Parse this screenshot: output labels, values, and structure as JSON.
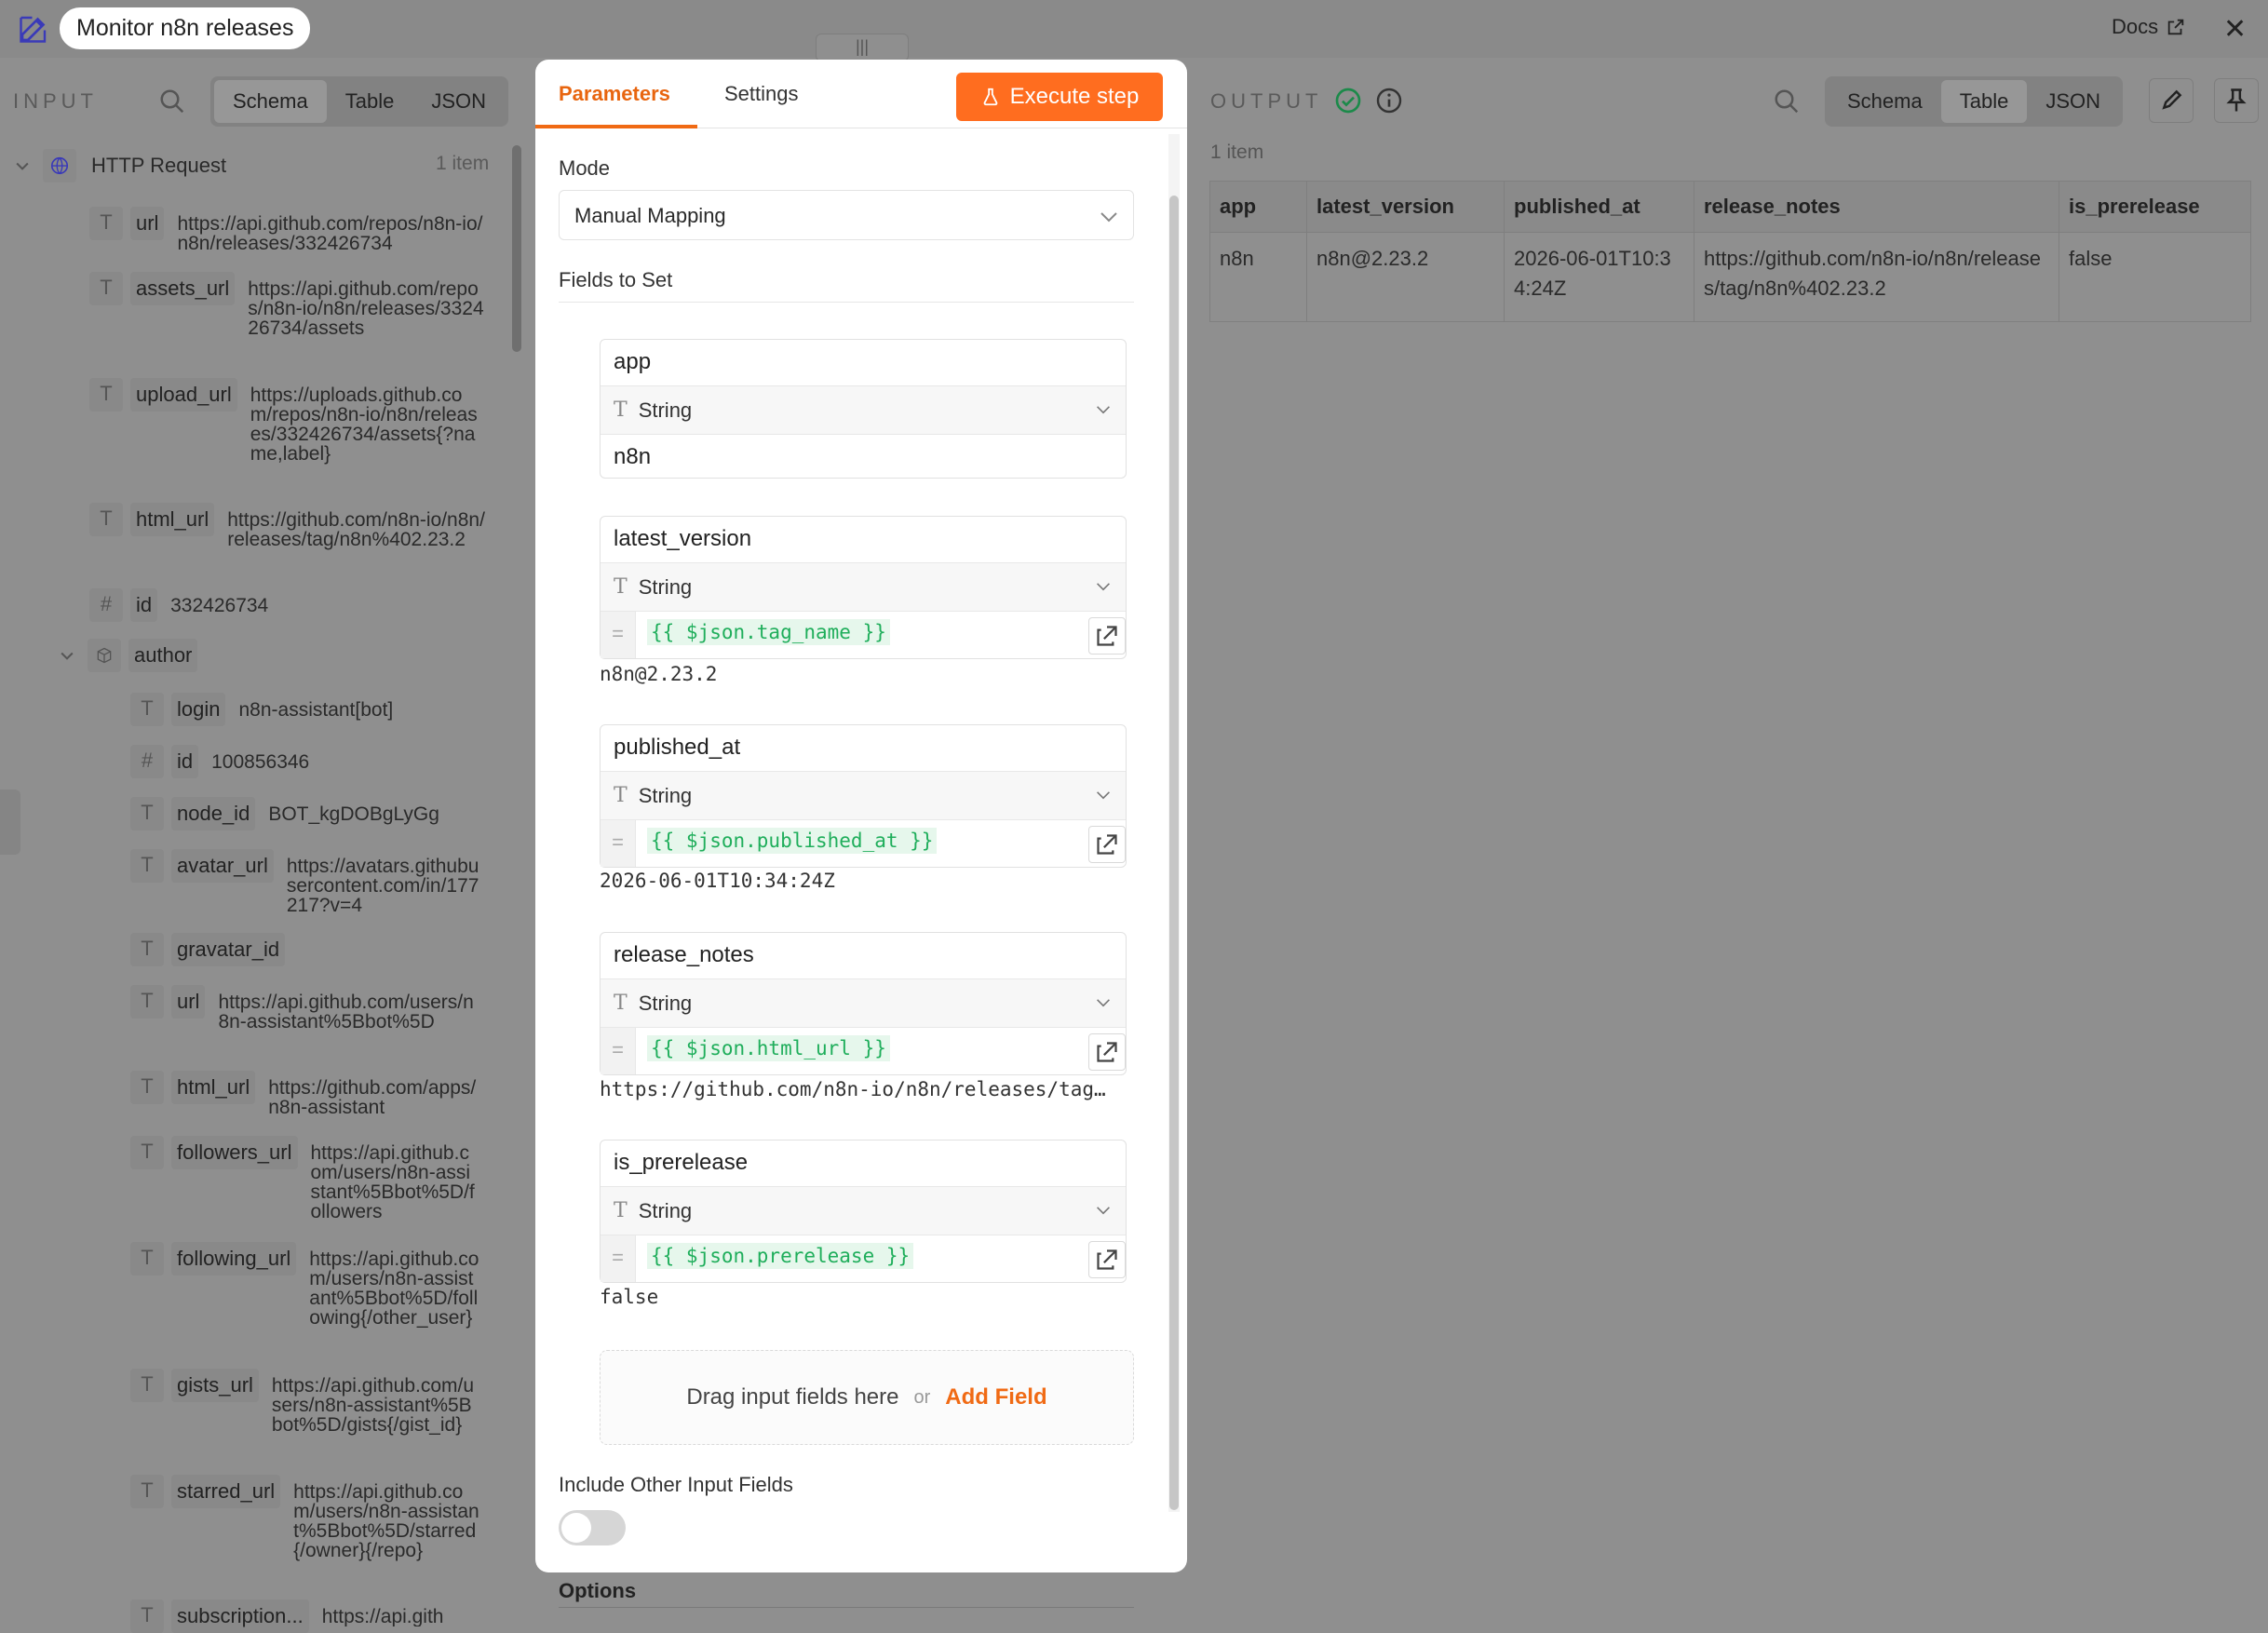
{
  "header": {
    "workflow_title": "Monitor n8n releases",
    "drag_handle": "|||",
    "docs_label": "Docs"
  },
  "input": {
    "label": "INPUT",
    "view_tabs": [
      "Schema",
      "Table",
      "JSON"
    ],
    "active_view": "Schema",
    "node_name": "HTTP Request",
    "item_count": "1 item",
    "fields": [
      {
        "type": "T",
        "key": "url",
        "value": "https://api.github.com/repos/n8n-io/n8n/releases/332426734"
      },
      {
        "type": "T",
        "key": "assets_url",
        "value": "https://api.github.com/repos/n8n-io/n8n/releases/332426734/assets"
      },
      {
        "type": "T",
        "key": "upload_url",
        "value": "https://uploads.github.com/repos/n8n-io/n8n/releases/332426734/assets{?name,label}"
      },
      {
        "type": "T",
        "key": "html_url",
        "value": "https://github.com/n8n-io/n8n/releases/tag/n8n%402.23.2"
      },
      {
        "type": "#",
        "key": "id",
        "value": "332426734"
      }
    ],
    "author": {
      "key": "author",
      "fields": [
        {
          "type": "T",
          "key": "login",
          "value": "n8n-assistant[bot]"
        },
        {
          "type": "#",
          "key": "id",
          "value": "100856346"
        },
        {
          "type": "T",
          "key": "node_id",
          "value": "BOT_kgDOBgLyGg"
        },
        {
          "type": "T",
          "key": "avatar_url",
          "value": "https://avatars.githubusercontent.com/in/177217?v=4"
        },
        {
          "type": "T",
          "key": "gravatar_id",
          "value": ""
        },
        {
          "type": "T",
          "key": "url",
          "value": "https://api.github.com/users/n8n-assistant%5Bbot%5D"
        },
        {
          "type": "T",
          "key": "html_url",
          "value": "https://github.com/apps/n8n-assistant"
        },
        {
          "type": "T",
          "key": "followers_url",
          "value": "https://api.github.com/users/n8n-assistant%5Bbot%5D/followers"
        },
        {
          "type": "T",
          "key": "following_url",
          "value": "https://api.github.com/users/n8n-assistant%5Bbot%5D/following{/other_user}"
        },
        {
          "type": "T",
          "key": "gists_url",
          "value": "https://api.github.com/users/n8n-assistant%5Bbot%5D/gists{/gist_id}"
        },
        {
          "type": "T",
          "key": "starred_url",
          "value": "https://api.github.com/users/n8n-assistant%5Bbot%5D/starred{/owner}{/repo}"
        },
        {
          "type": "T",
          "key": "subscription...",
          "value": "https://api.gith"
        }
      ]
    }
  },
  "modal": {
    "tabs": [
      "Parameters",
      "Settings"
    ],
    "active_tab": "Parameters",
    "execute_label": "Execute step",
    "mode_label": "Mode",
    "mode_value": "Manual Mapping",
    "fields_label": "Fields to Set",
    "fields": [
      {
        "name": "app",
        "type": "String",
        "value": "n8n",
        "expression": "",
        "preview": ""
      },
      {
        "name": "latest_version",
        "type": "String",
        "value": "",
        "expression": "{{ $json.tag_name }}",
        "preview": "n8n@2.23.2"
      },
      {
        "name": "published_at",
        "type": "String",
        "value": "",
        "expression": "{{ $json.published_at }}",
        "preview": "2026-06-01T10:34:24Z"
      },
      {
        "name": "release_notes",
        "type": "String",
        "value": "",
        "expression": "{{ $json.html_url }}",
        "preview": "https://github.com/n8n-io/n8n/releases/tag…"
      },
      {
        "name": "is_prerelease",
        "type": "String",
        "value": "",
        "expression": "{{ $json.prerelease }}",
        "preview": "false"
      }
    ],
    "drop_text": "Drag input fields here",
    "drop_or": "or",
    "add_field": "Add Field",
    "include_label": "Include Other Input Fields",
    "include_enabled": false,
    "options_label": "Options"
  },
  "output": {
    "label": "OUTPUT",
    "view_tabs": [
      "Schema",
      "Table",
      "JSON"
    ],
    "active_view": "Table",
    "item_count": "1 item",
    "columns": [
      "app",
      "latest_version",
      "published_at",
      "release_notes",
      "is_prerelease"
    ],
    "row": [
      "n8n",
      "n8n@2.23.2",
      "2026-06-01T10:34:24Z",
      "https://github.com/n8n-io/n8n/releases/tag/n8n%402.23.2",
      "false"
    ]
  },
  "colors": {
    "accent": "#ff6d1f",
    "expression_green": "#1fae5b",
    "success": "#1c8a4a"
  }
}
